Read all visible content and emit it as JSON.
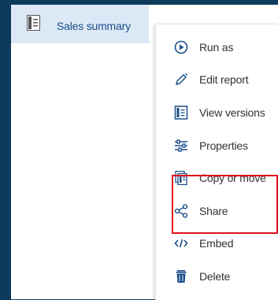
{
  "list": {
    "item_label": "Sales summary"
  },
  "menu": {
    "items": [
      {
        "label": "Run as",
        "icon": "play-circle-icon"
      },
      {
        "label": "Edit report",
        "icon": "pencil-icon"
      },
      {
        "label": "View versions",
        "icon": "versions-icon"
      },
      {
        "label": "Properties",
        "icon": "sliders-icon"
      },
      {
        "label": "Copy or move",
        "icon": "copy-icon"
      },
      {
        "label": "Share",
        "icon": "share-icon"
      },
      {
        "label": "Embed",
        "icon": "code-icon"
      },
      {
        "label": "Delete",
        "icon": "trash-icon"
      }
    ]
  },
  "colors": {
    "background": "#0e3a5c",
    "selected_item": "#dce8f6",
    "highlight_box": "#e0101a",
    "icon_blue": "#1a4f8a"
  }
}
